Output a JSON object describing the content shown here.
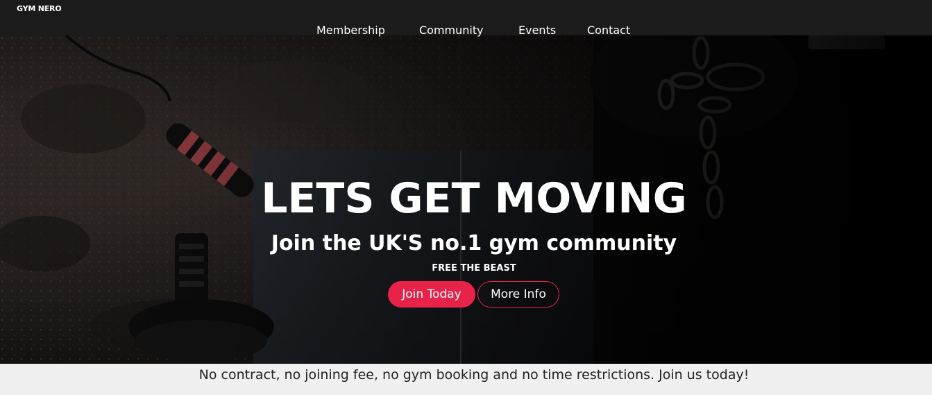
{
  "header": {
    "brand": "GYM NERO",
    "nav": [
      {
        "label": "Membership"
      },
      {
        "label": "Community"
      },
      {
        "label": "Events"
      },
      {
        "label": "Contact"
      }
    ]
  },
  "hero": {
    "title": "LETS GET MOVING",
    "subtitle": "Join the UK'S no.1 gym community",
    "tagline": "FREE THE BEAST",
    "primary_button": "Join Today",
    "secondary_button": "More Info"
  },
  "info_strip": {
    "text": "No contract, no joining fee, no gym booking and no time restrictions. Join us today!"
  },
  "colors": {
    "accent": "#e8234a",
    "header_bg": "#1b1b1b",
    "strip_bg": "#f0f0f0"
  }
}
